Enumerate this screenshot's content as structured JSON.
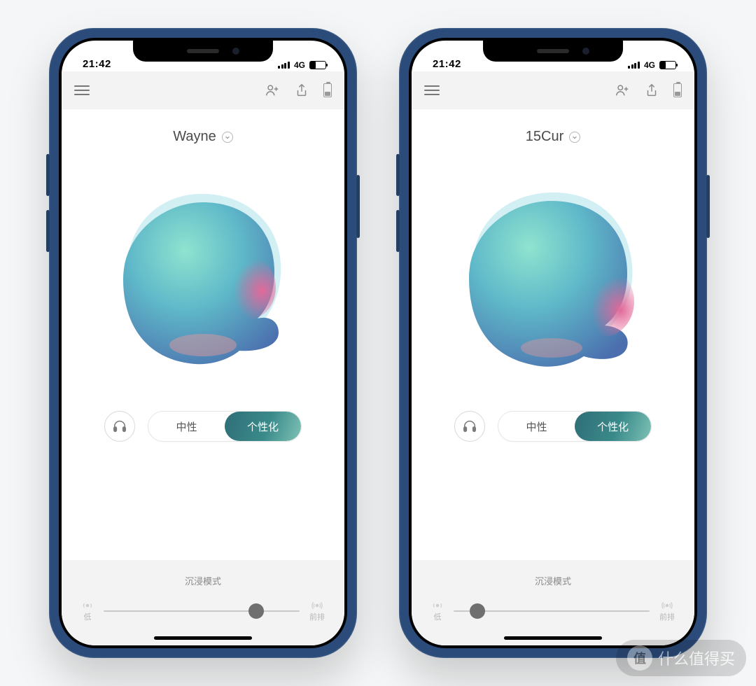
{
  "status": {
    "time": "21:42",
    "network": "4G",
    "battery_pct": "30%"
  },
  "appbar": {
    "device_battery_pct": "30%"
  },
  "segment": {
    "neutral": "中性",
    "personalized": "个性化"
  },
  "slider": {
    "title": "沉浸模式",
    "low": "低",
    "high": "前排"
  },
  "phones": [
    {
      "profile_name": "Wayne",
      "slider_position_pct": 78
    },
    {
      "profile_name": "15Cur",
      "slider_position_pct": 12
    }
  ],
  "watermark": {
    "badge": "值",
    "text": "什么值得买"
  }
}
